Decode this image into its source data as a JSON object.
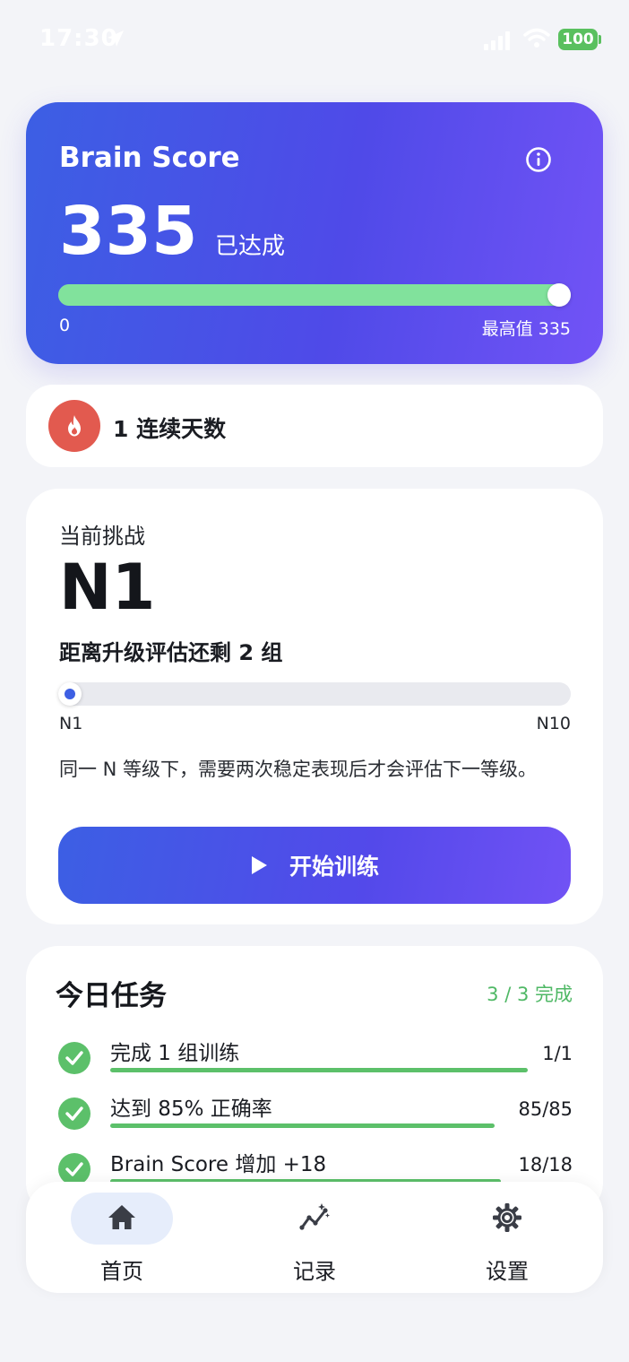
{
  "status_bar": {
    "time": "17:30",
    "battery": "100",
    "battery_color": "#5ac05f"
  },
  "score_card": {
    "title": "Brain Score",
    "value": "335",
    "status": "已达成",
    "progress_fraction": 1.0,
    "range_min": "0",
    "range_max": "最高值 335",
    "info_icon": "info-icon"
  },
  "streak": {
    "text": "1 连续天数",
    "icon": "flame-icon",
    "badge_color": "#e25a4f"
  },
  "challenge": {
    "label": "当前挑战",
    "level": "N1",
    "remaining": "距离升级评估还剩 2 组",
    "level_fraction": 0.0,
    "range_min": "N1",
    "range_max": "N10",
    "note": "同一 N 等级下，需要两次稳定表现后才会评估下一等级。",
    "start_button": "开始训练"
  },
  "tasks": {
    "title": "今日任务",
    "progress": "3 / 3 完成",
    "items": [
      {
        "label": "完成 1 组训练",
        "value": "1/1",
        "done": true,
        "progress": 1.0
      },
      {
        "label": "达到 85% 正确率",
        "value": "85/85",
        "done": true,
        "progress": 1.0
      },
      {
        "label": "Brain Score 增加 +18",
        "value": "18/18",
        "done": true,
        "progress": 1.0
      }
    ]
  },
  "nav": {
    "items": [
      {
        "label": "首页",
        "icon": "home-icon",
        "active": true
      },
      {
        "label": "记录",
        "icon": "chart-icon",
        "active": false
      },
      {
        "label": "设置",
        "icon": "gear-icon",
        "active": false
      }
    ]
  },
  "colors": {
    "accent": "#3d5fe3",
    "gradient_start": "#3c5fe4",
    "gradient_end": "#7253f6",
    "success": "#5cc06a",
    "score_fill": "#81e29c"
  }
}
